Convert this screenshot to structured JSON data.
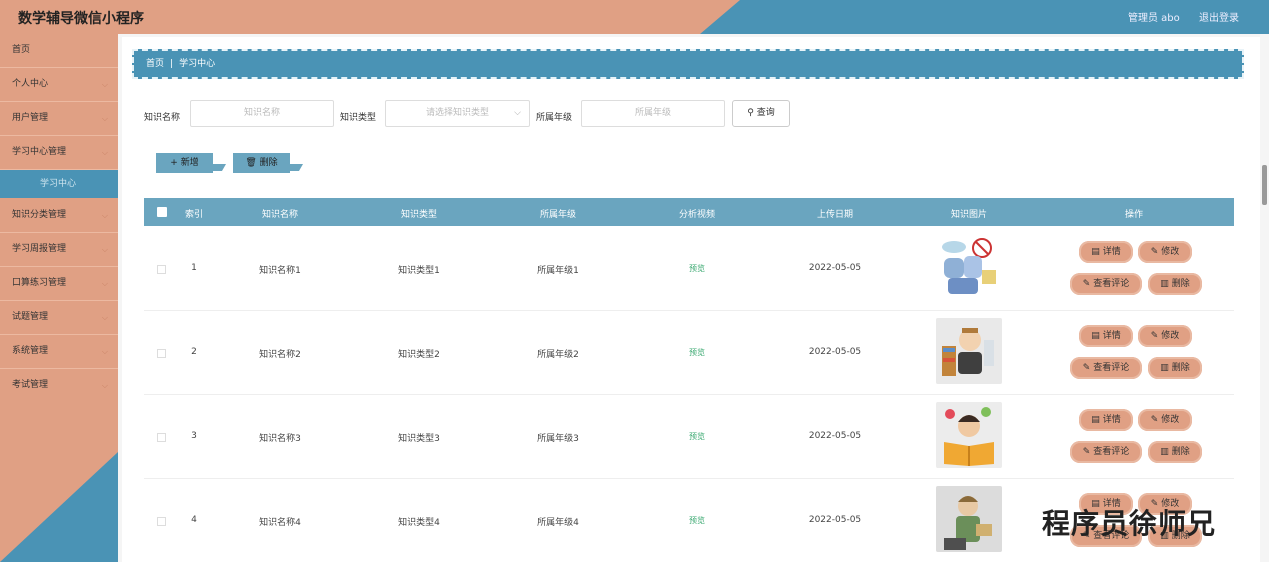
{
  "header": {
    "title": "数学辅导微信小程序",
    "user": "管理员 abo",
    "logout": "退出登录"
  },
  "sidebar": {
    "items": [
      {
        "label": "首页",
        "chevron": false
      },
      {
        "label": "个人中心",
        "chevron": true
      },
      {
        "label": "用户管理",
        "chevron": true
      },
      {
        "label": "学习中心管理",
        "chevron": true
      },
      {
        "label": "知识分类管理",
        "chevron": true
      },
      {
        "label": "学习周报管理",
        "chevron": true
      },
      {
        "label": "口算练习管理",
        "chevron": true
      },
      {
        "label": "试题管理",
        "chevron": true
      },
      {
        "label": "系统管理",
        "chevron": true
      },
      {
        "label": "考试管理",
        "chevron": true
      }
    ],
    "sub_active": "学习中心"
  },
  "breadcrumb": {
    "home": "首页",
    "sep": "|",
    "current": "学习中心"
  },
  "search": {
    "name_label": "知识名称",
    "name_placeholder": "知识名称",
    "type_label": "知识类型",
    "type_placeholder": "请选择知识类型",
    "grade_label": "所属年级",
    "grade_placeholder": "所属年级",
    "button": "查询"
  },
  "actions": {
    "add": "新增",
    "delete": "删除"
  },
  "table": {
    "headers": [
      "索引",
      "知识名称",
      "知识类型",
      "所属年级",
      "分析视频",
      "上传日期",
      "知识图片",
      "操作"
    ],
    "rows": [
      {
        "index": "1",
        "name": "知识名称1",
        "type": "知识类型1",
        "grade": "所属年级1",
        "video": "预览",
        "date": "2022-05-05"
      },
      {
        "index": "2",
        "name": "知识名称2",
        "type": "知识类型2",
        "grade": "所属年级2",
        "video": "预览",
        "date": "2022-05-05"
      },
      {
        "index": "3",
        "name": "知识名称3",
        "type": "知识类型3",
        "grade": "所属年级3",
        "video": "预览",
        "date": "2022-05-05"
      },
      {
        "index": "4",
        "name": "知识名称4",
        "type": "知识类型4",
        "grade": "所属年级4",
        "video": "预览",
        "date": "2022-05-05"
      }
    ],
    "row_actions": {
      "detail": "详情",
      "edit": "修改",
      "comments": "查看评论",
      "delete": "删除"
    }
  },
  "watermark": "程序员徐师兄",
  "colors": {
    "salmon": "#e0a084",
    "teal": "#4a93b5",
    "header_row": "#6aa5bf",
    "preview_green": "#3aa870"
  }
}
